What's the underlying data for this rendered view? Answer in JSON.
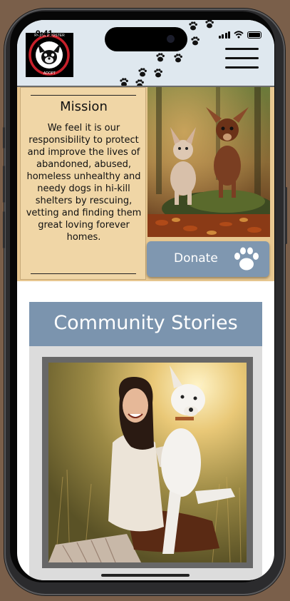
{
  "status_bar": {
    "time": "9:41",
    "signal_icon": "cellular-signal-icon",
    "wifi_icon": "wifi-icon",
    "battery_icon": "battery-icon"
  },
  "header": {
    "logo": {
      "icon": "chihuahua-rescue-logo",
      "top_text": "RESCUE FOSTER",
      "bottom_text": "ADOPT"
    },
    "menu_icon": "hamburger-menu-icon",
    "decoration_icon": "paw-prints-icon",
    "background_color": "#dfe8ef"
  },
  "mission": {
    "title": "Mission",
    "text": "We feel it is our responsibility to protect and improve the lives of abandoned, abused, homeless unhealthy and needy dogs in hi-kill shelters by rescuing, vetting and finding them great loving forever homes.",
    "background_color": "#f0d6a6"
  },
  "hero_image": {
    "description": "two chihuahuas on mossy stump in autumn leaves"
  },
  "donate": {
    "label": "Donate",
    "icon": "paw-icon",
    "color": "#7f97b0"
  },
  "stories": {
    "title": "Community Stories",
    "title_bar_color": "#7b94ae",
    "photo": {
      "description": "smiling woman lifting a white dog in a sunny field"
    }
  }
}
